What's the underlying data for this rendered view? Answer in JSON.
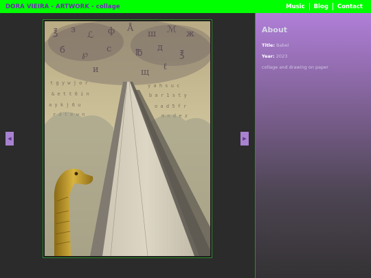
{
  "header": {
    "title": "DORA VIEIRA - ARTWORK - collage",
    "nav": [
      {
        "label": "Music"
      },
      {
        "label": "Blog"
      },
      {
        "label": "Contact"
      }
    ]
  },
  "gallery": {
    "prev_icon": "chevron-left-icon",
    "next_icon": "chevron-right-icon"
  },
  "about": {
    "heading": "About",
    "title_label": "Title:",
    "title_value": "Babel",
    "year_label": "Year:",
    "year_value": "2023",
    "description": "collage and drawing on paper"
  },
  "colors": {
    "header_bg": "#00ff00",
    "title_color": "#6a2fb0",
    "arrow_bg": "#a882d0",
    "sidebar_top": "#b07fd8"
  }
}
